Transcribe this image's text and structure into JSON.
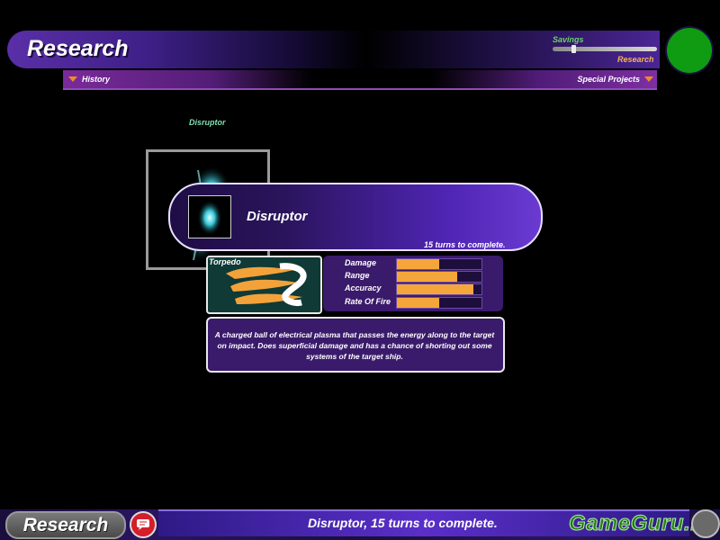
{
  "header": {
    "title": "Research",
    "savings_label": "Savings",
    "research_label": "Research",
    "savings_value": 0.2,
    "status_color": "#0f9b12"
  },
  "subbar": {
    "history_label": "History",
    "special_label": "Special Projects"
  },
  "tree": {
    "item_label": "Disruptor"
  },
  "info": {
    "name": "Disruptor",
    "turns_text": "15 turns to complete."
  },
  "weapon": {
    "type_label": "Torpedo",
    "stats": [
      {
        "label": "Damage",
        "value": 0.5
      },
      {
        "label": "Range",
        "value": 0.71
      },
      {
        "label": "Accuracy",
        "value": 0.9
      },
      {
        "label": "Rate Of Fire",
        "value": 0.5
      }
    ],
    "description": "A charged ball of electrical plasma that passes the energy along to the target on impact.  Does superficial damage and has a chance of shorting out some systems of the target ship."
  },
  "footer": {
    "mode_label": "Research",
    "status_text": "Disruptor, 15 turns to complete.",
    "watermark": "GameGuru.ru",
    "icons": {
      "chat": "chat-bubble-icon",
      "end": "end-turn-icon"
    }
  },
  "colors": {
    "accent": "#4f25b4",
    "stat_fill": "#f4a63b"
  }
}
